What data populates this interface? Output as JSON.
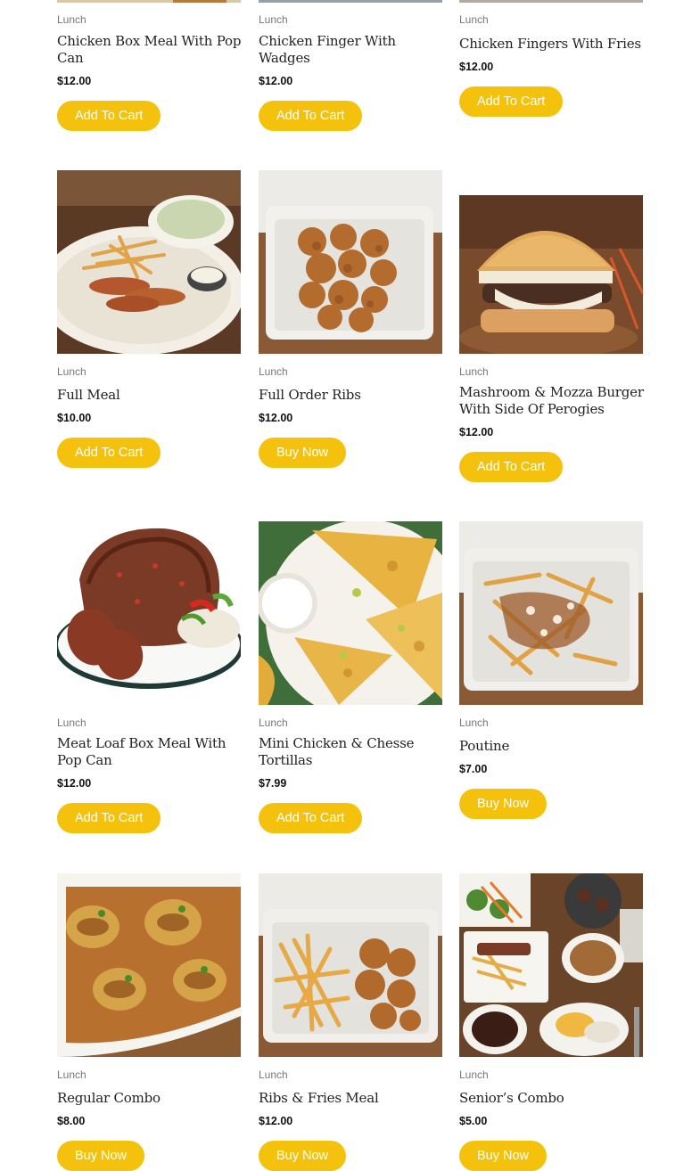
{
  "products": [
    {
      "category": "Lunch",
      "name": "Chicken Box Meal With Pop Can",
      "price": "$12.00",
      "button": "Add To Cart"
    },
    {
      "category": "Lunch",
      "name": "Chicken Finger With Wadges",
      "price": "$12.00",
      "button": "Add To Cart"
    },
    {
      "category": "Lunch",
      "name": "Chicken Fingers With Fries",
      "price": "$12.00",
      "button": "Add To Cart"
    },
    {
      "category": "Lunch",
      "name": "Full Meal",
      "price": "$10.00",
      "button": "Add To Cart"
    },
    {
      "category": "Lunch",
      "name": "Full Order Ribs",
      "price": "$12.00",
      "button": "Buy Now"
    },
    {
      "category": "Lunch",
      "name": "Mashroom & Mozza Burger With Side Of Perogies",
      "price": "$12.00",
      "button": "Add To Cart"
    },
    {
      "category": "Lunch",
      "name": "Meat Loaf Box Meal With Pop Can",
      "price": "$12.00",
      "button": "Add To Cart"
    },
    {
      "category": "Lunch",
      "name": "Mini Chicken & Chesse Tortillas",
      "price": "$7.99",
      "button": "Add To Cart"
    },
    {
      "category": "Lunch",
      "name": "Poutine",
      "price": "$7.00",
      "button": "Buy Now"
    },
    {
      "category": "Lunch",
      "name": "Regular Combo",
      "price": "$8.00",
      "button": "Buy Now"
    },
    {
      "category": "Lunch",
      "name": "Ribs & Fries Meal",
      "price": "$12.00",
      "button": "Buy Now"
    },
    {
      "category": "Lunch",
      "name": "Senior’s Combo",
      "price": "$5.00",
      "button": "Buy Now"
    }
  ],
  "images": [
    "chicken-box-meal-photo",
    "chicken-finger-wedges-photo",
    "chicken-fingers-fries-photo",
    "full-meal-photo",
    "full-order-ribs-photo",
    "mushroom-burger-photo",
    "meat-loaf-photo",
    "quesadilla-photo",
    "poutine-photo",
    "cabbage-rolls-photo",
    "ribs-fries-photo",
    "seniors-combo-photo"
  ],
  "colors": {
    "button": "#f4c20d",
    "button_text": "#ffffff",
    "category": "#777777",
    "title": "#222222"
  }
}
